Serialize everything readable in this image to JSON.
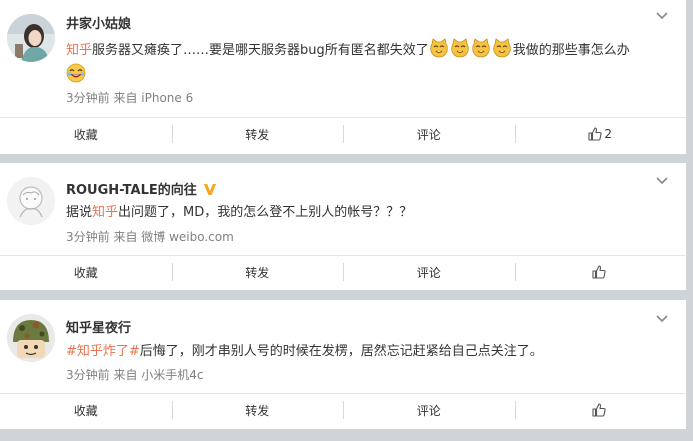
{
  "posts": [
    {
      "username": "井家小姑娘",
      "verified": false,
      "topic": "知乎",
      "text_before": "服务器又瘫痪了……要是哪天服务器bug所有匿名都失效了",
      "text_after": "我做的那些事怎么办",
      "emoji": [
        "cat-face-icon",
        "cat-face-icon",
        "cat-face-icon",
        "cat-face-icon",
        "laughing-face-icon"
      ],
      "meta": "3分钟前 来自 iPhone 6",
      "actions": {
        "collect": "收藏",
        "repost": "转发",
        "comment": "评论",
        "like_count": "2"
      }
    },
    {
      "username": "ROUGH-TALE的向往",
      "verified": true,
      "text_prefix": "据说",
      "topic": "知乎",
      "text_after": "出问题了，MD，我的怎么登不上别人的帐号？？？",
      "meta": "3分钟前 来自 微博 weibo.com",
      "actions": {
        "collect": "收藏",
        "repost": "转发",
        "comment": "评论",
        "like_count": ""
      }
    },
    {
      "username": "知乎星夜行",
      "verified": false,
      "hashtag": "#知乎炸了#",
      "text_after": "后悔了，刚才串别人号的时候在发楞，居然忘记赶紧给自己点关注了。",
      "meta": "3分钟前 来自 小米手机4c",
      "actions": {
        "collect": "收藏",
        "repost": "转发",
        "comment": "评论",
        "like_count": ""
      }
    }
  ],
  "colors": {
    "background": "#cfd4d9",
    "card": "#ffffff",
    "link_accent": "#eb7350",
    "meta": "#808080",
    "verified_badge": "#f6a623"
  }
}
